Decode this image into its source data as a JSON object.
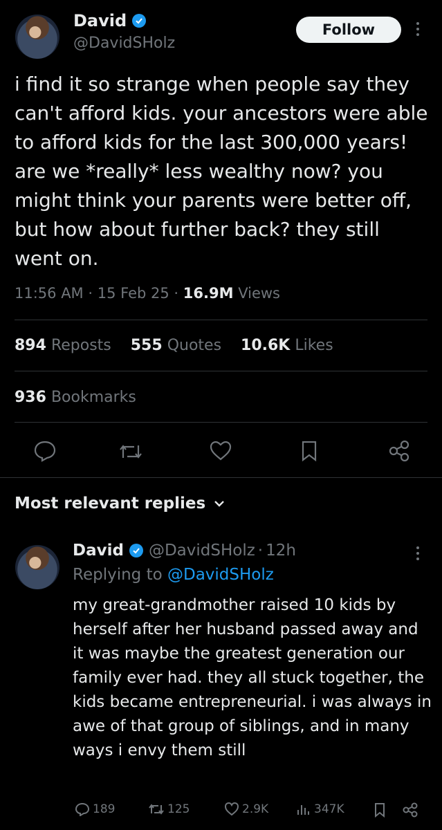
{
  "tweet": {
    "author_name": "David",
    "author_handle": "@DavidSHolz",
    "follow_label": "Follow",
    "text": "i find it so strange when people say they can't afford kids. your ancestors were able to afford kids for the last 300,000 years! are we *really* less wealthy now? you might think your parents were better off, but how about further back? they still went on.",
    "time": "11:56 AM",
    "date": "15 Feb 25",
    "separator": "·",
    "views_count": "16.9M",
    "views_label": "Views",
    "icons": {
      "avatar": "avatar-image",
      "verified": "verified-badge-icon",
      "more": "more-options-icon"
    }
  },
  "stats": {
    "reposts_count": "894",
    "reposts_label": "Reposts",
    "quotes_count": "555",
    "quotes_label": "Quotes",
    "likes_count": "10.6K",
    "likes_label": "Likes",
    "bookmarks_count": "936",
    "bookmarks_label": "Bookmarks"
  },
  "actions": [
    "reply-icon",
    "repost-icon",
    "like-icon",
    "bookmark-icon",
    "share-icon"
  ],
  "replies": {
    "sort_label": "Most relevant replies",
    "items": [
      {
        "author_name": "David",
        "author_handle": "@DavidSHolz",
        "separator": "·",
        "time": "12h",
        "replying_prefix": "Replying to",
        "replying_handle": "@DavidSHolz",
        "text": "my great-grandmother raised 10 kids by herself after her husband passed away and it was maybe the greatest generation our family ever had. they all stuck together, the kids became entrepreneurial. i was always in awe of that group of siblings, and in many ways i envy them still",
        "replies_count": "189",
        "reposts_count": "125",
        "likes_count": "2.9K",
        "views_count": "347K"
      }
    ]
  },
  "colors": {
    "background": "#000000",
    "text": "#e7e9ea",
    "muted": "#71767b",
    "accent": "#1d9bf0",
    "divider": "#2f3336"
  }
}
